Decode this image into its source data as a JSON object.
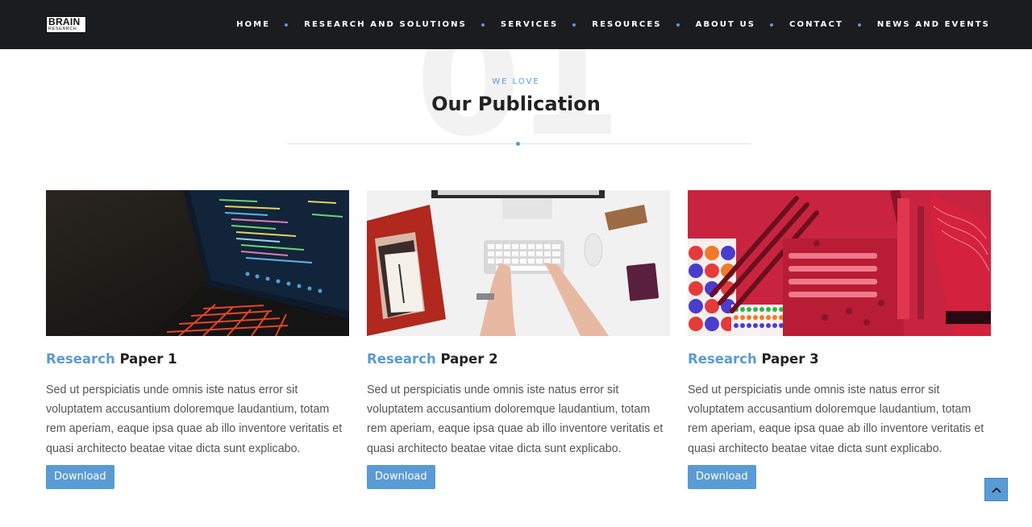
{
  "header": {
    "logo": {
      "line1": "BRAIN",
      "line2": "RESEARCH"
    },
    "nav": [
      {
        "label": "HOME"
      },
      {
        "label": "RESEARCH AND SOLUTIONS"
      },
      {
        "label": "SERVICES"
      },
      {
        "label": "RESOURCES"
      },
      {
        "label": "ABOUT US"
      },
      {
        "label": "CONTACT"
      },
      {
        "label": "NEWS AND EVENTS"
      }
    ]
  },
  "section": {
    "number": "01",
    "eyebrow": "WE LOVE",
    "title": "Our Publication"
  },
  "cards": [
    {
      "title_accent": "Research",
      "title_rest": " Paper 1",
      "text": "Sed ut perspiciatis unde omnis iste natus error sit voluptatem accusantium doloremque laudantium, totam rem aperiam, eaque ipsa quae ab illo inventore veritatis et quasi architecto beatae vitae dicta sunt explicabo.",
      "button": "Download",
      "image": "laptop-code-photo"
    },
    {
      "title_accent": "Research",
      "title_rest": " Paper 2",
      "text": "Sed ut perspiciatis unde omnis iste natus error sit voluptatem accusantium doloremque laudantium, totam rem aperiam, eaque ipsa quae ab illo inventore veritatis et quasi architecto beatae vitae dicta sunt explicabo.",
      "button": "Download",
      "image": "desk-keyboard-photo"
    },
    {
      "title_accent": "Research",
      "title_rest": " Paper 3",
      "text": "Sed ut perspiciatis unde omnis iste natus error sit voluptatem accusantium doloremque laudantium, totam rem aperiam, eaque ipsa quae ab illo inventore veritatis et quasi architecto beatae vitae dicta sunt explicabo.",
      "button": "Download",
      "image": "red-stationery-photo"
    }
  ],
  "scroll_top": {
    "icon": "chevron-up-icon"
  },
  "colors": {
    "accent": "#5a9bd5",
    "header_bg": "#1b1c1e",
    "heading": "#222222",
    "body_text": "#555555"
  }
}
